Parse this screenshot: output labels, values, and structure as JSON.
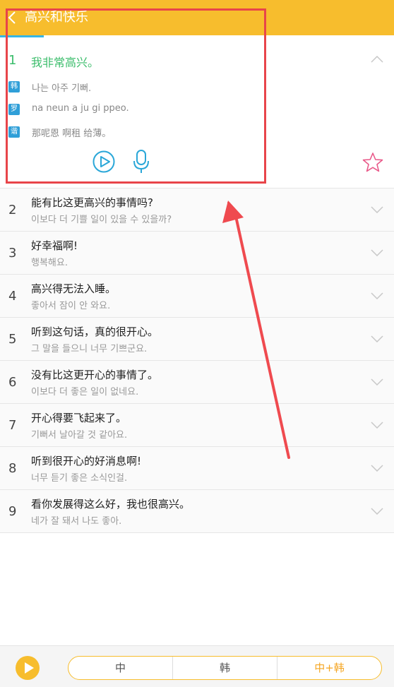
{
  "header": {
    "title": "高兴和快乐"
  },
  "expanded": {
    "number": "1",
    "chinese": "我非常高兴。",
    "rows": [
      {
        "tag": "韩",
        "text": "나는 아주 기뻐."
      },
      {
        "tag": "罗",
        "text": "na neun a ju gi ppeo."
      },
      {
        "tag": "谐",
        "text": "那呢恩 啊租 给薄。"
      }
    ]
  },
  "sentences": [
    {
      "num": "2",
      "zh": "能有比这更高兴的事情吗?",
      "ko": "이보다 더 기쁠 일이 있을 수 있을까?"
    },
    {
      "num": "3",
      "zh": "好幸福啊!",
      "ko": "행복해요."
    },
    {
      "num": "4",
      "zh": "高兴得无法入睡。",
      "ko": "좋아서 잠이 안 와요."
    },
    {
      "num": "5",
      "zh": "听到这句话，真的很开心。",
      "ko": "그 말을 들으니 너무 기쁘군요."
    },
    {
      "num": "6",
      "zh": "没有比这更开心的事情了。",
      "ko": "이보다 더 좋은 일이 없네요."
    },
    {
      "num": "7",
      "zh": "开心得要飞起来了。",
      "ko": "기뻐서 날아갈 것 같아요."
    },
    {
      "num": "8",
      "zh": "听到很开心的好消息啊!",
      "ko": "너무 듣기 좋은 소식인걸."
    },
    {
      "num": "9",
      "zh": "看你发展得这么好，我也很高兴。",
      "ko": "네가 잘 돼서 나도 좋아."
    }
  ],
  "footer": {
    "modes": [
      "中",
      "韩",
      "中+韩"
    ],
    "active_mode": "中+韩"
  },
  "colors": {
    "brand": "#f7bd2d",
    "accent_green": "#3bbd6b",
    "annotation_red": "#e8454a",
    "tag_blue": "#2f9fd8"
  }
}
